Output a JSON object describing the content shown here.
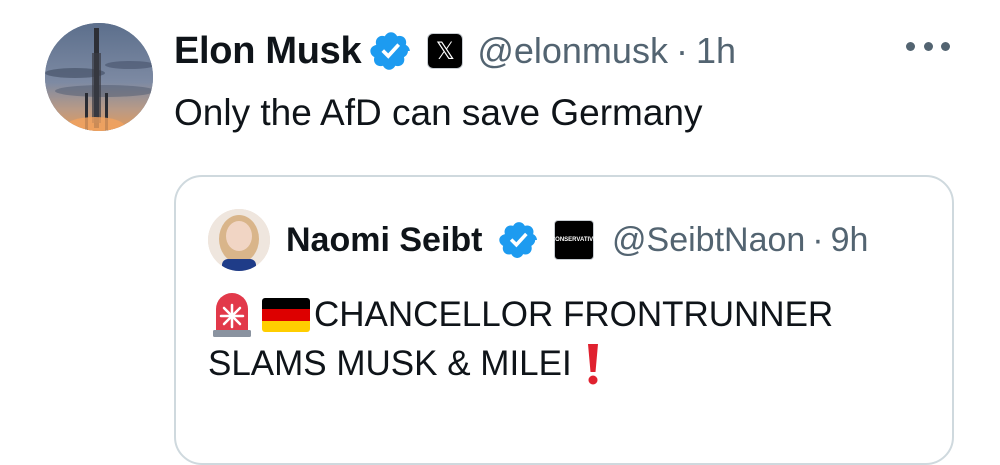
{
  "tweet": {
    "author_name": "Elon Musk",
    "affiliation_badge": "𝕏",
    "handle": "@elonmusk",
    "separator": "·",
    "time": "1h",
    "text": "Only the AfD can save Germany",
    "verified_color": "#1d9bf0"
  },
  "quote": {
    "author_name": "Naomi Seibt",
    "affiliation_badge": "CONSERVATIVE",
    "handle": "@SeibtNaon",
    "separator": "·",
    "time": "9h",
    "line1": "CHANCELLOR FRONTRUNNER",
    "line2": "SLAMS MUSK & MILEI",
    "icons": [
      "siren-icon",
      "germany-flag-icon",
      "exclamation-icon"
    ],
    "flag_colors": [
      "#000000",
      "#dd0000",
      "#ffce00"
    ]
  }
}
